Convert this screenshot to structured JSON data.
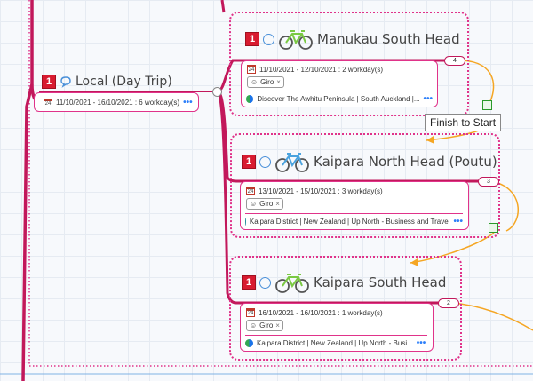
{
  "root": {
    "badge": "1",
    "title": "Local (Day Trip)",
    "date_range": "11/10/2021 - 16/10/2021 : 6 workday(s)",
    "calendar_day": "24"
  },
  "topics": [
    {
      "badge": "1",
      "title": "Manukau South Head",
      "date_range": "11/10/2021 - 12/10/2021 : 2 workday(s)",
      "calendar_day": "24",
      "tag": "Giro",
      "link": "Discover The Awhitu Peninsula | South Auckland |...",
      "count": "4"
    },
    {
      "badge": "1",
      "title": "Kaipara North Head (Poutu)",
      "date_range": "13/10/2021 - 15/10/2021 : 3 workday(s)",
      "calendar_day": "24",
      "tag": "Giro",
      "link": "Kaipara District | New Zealand | Up North - Business and Travel",
      "count": "3"
    },
    {
      "badge": "1",
      "title": "Kaipara South Head",
      "date_range": "16/10/2021 - 16/10/2021 : 1 workday(s)",
      "calendar_day": "24",
      "tag": "Giro",
      "link": "Kaipara District | New Zealand | Up North - Busi...",
      "count": "2"
    }
  ],
  "dependency_tooltip": "Finish to Start",
  "more_dots": "•••",
  "tag_close": "×",
  "collapse_symbol": "−",
  "colors": {
    "branch": "#c2185b",
    "frame": "#e0338a",
    "dependency": "#f5a623",
    "badge": "#d81b30",
    "link": "#2d7ff9"
  }
}
